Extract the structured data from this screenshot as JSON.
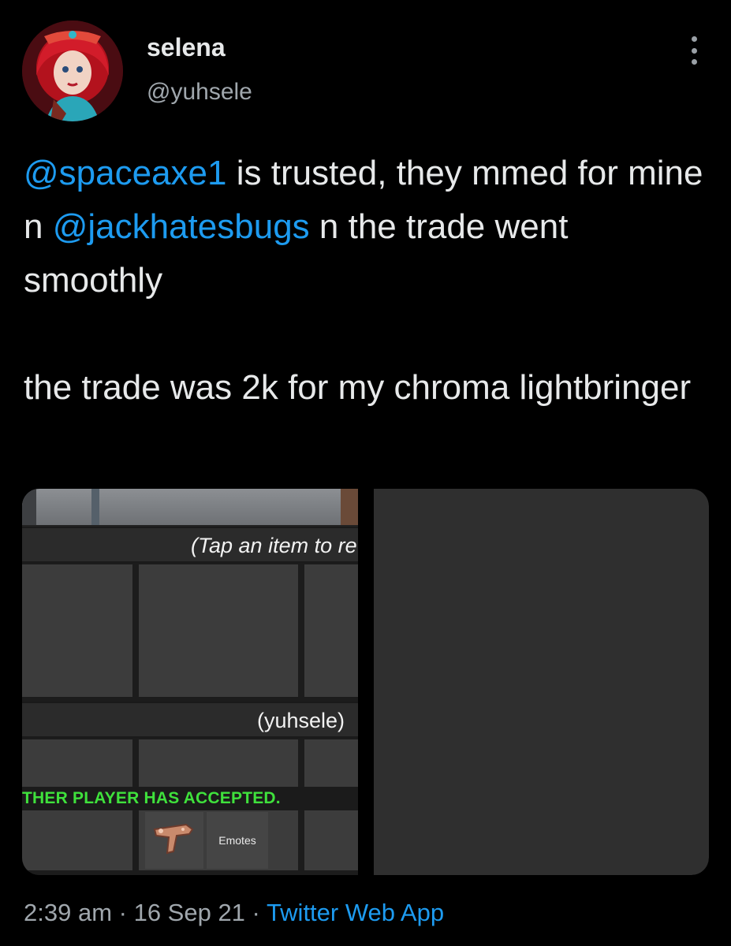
{
  "author": {
    "display_name": "selena",
    "handle": "@yuhsele"
  },
  "icons": {
    "avatar": "profile-avatar",
    "more": "more-vertical-icon",
    "gun_item": "gun-item-icon"
  },
  "tweet": {
    "line1_mention": "@spaceaxe1",
    "line1_text": " is trusted, they mmed for mine n ",
    "line1_mention2": "@jackhatesbugs",
    "line1_tail": " n the trade went smoothly",
    "para2": "the trade was 2k for my chroma lightbringer"
  },
  "media": {
    "tap_hint": "(Tap an item to re",
    "player_label": "(yuhsele)",
    "accepted": "THER PLAYER HAS ACCEPTED.",
    "emotes": "Emotes"
  },
  "meta": {
    "time": "2:39 am",
    "sep1": " · ",
    "date": "16 Sep 21",
    "sep2": " · ",
    "app": "Twitter Web App"
  },
  "colors": {
    "link": "#1d9bf0",
    "accepted_text": "#3fe13c",
    "background": "#000000"
  }
}
